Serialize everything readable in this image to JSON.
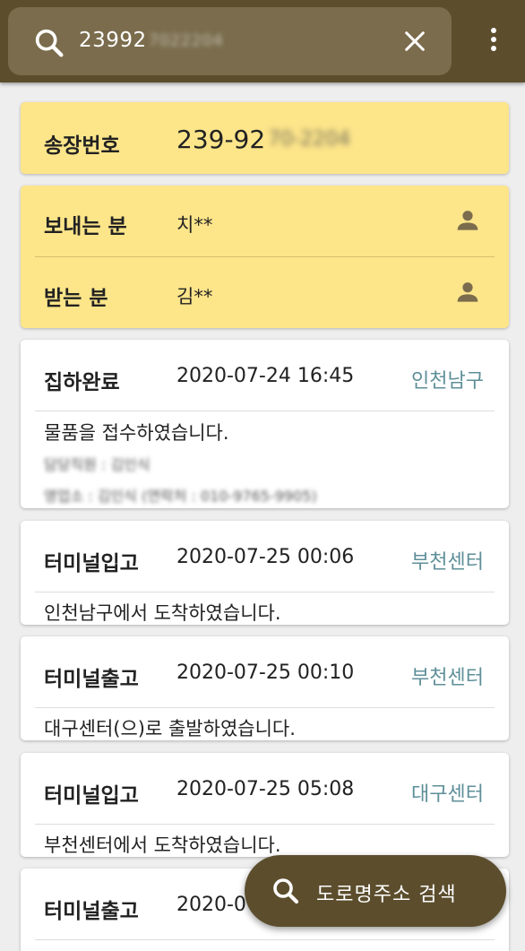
{
  "search": {
    "value": "23992",
    "value_redacted": "7022204"
  },
  "invoice": {
    "label": "송장번호",
    "value": "239-92",
    "value_redacted": "70-2204"
  },
  "sender": {
    "label": "보내는 분",
    "value": "치**"
  },
  "receiver": {
    "label": "받는 분",
    "value": "김**"
  },
  "tracking": [
    {
      "status": "집하완료",
      "datetime": "2020-07-24 16:45",
      "location": "인천남구",
      "message": "물품을 접수하였습니다.",
      "redacted_lines": [
        "담당직원 : 김인식",
        "영업소 : 김인식 (연락처 : 010-9765-9905)"
      ]
    },
    {
      "status": "터미널입고",
      "datetime": "2020-07-25 00:06",
      "location": "부천센터",
      "message": "인천남구에서 도착하였습니다."
    },
    {
      "status": "터미널출고",
      "datetime": "2020-07-25 00:10",
      "location": "부천센터",
      "message": "대구센터(으)로 출발하였습니다."
    },
    {
      "status": "터미널입고",
      "datetime": "2020-07-25 05:08",
      "location": "대구센터",
      "message": "부천센터에서 도착하였습니다."
    },
    {
      "status": "터미널출고",
      "datetime": "2020-0",
      "location": ""
    }
  ],
  "fab": {
    "label": "도로명주소 검색"
  },
  "icons": {
    "search": "search-icon",
    "clear": "close-icon",
    "more": "more-vert-icon",
    "person": "person-icon"
  },
  "colors": {
    "topbar": "#5c4e2d",
    "searchbox": "#7a6c4c",
    "yellow_card": "#fde58a",
    "location_text": "#5e8f98",
    "background": "#eeeeee"
  }
}
